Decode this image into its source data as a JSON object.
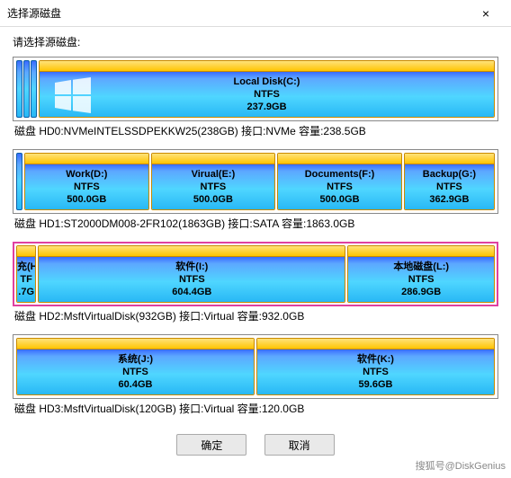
{
  "window": {
    "title": "选择源磁盘",
    "close_label": "×"
  },
  "prompt": "请选择源磁盘:",
  "disks": [
    {
      "label": "磁盘 HD0:NVMeINTELSSDPEKKW25(238GB)  接口:NVMe  容量:238.5GB",
      "reserved_bars": 3,
      "has_win_logo": true,
      "selected": false,
      "partitions": [
        {
          "name": "Local Disk(C:)",
          "fs": "NTFS",
          "size": "237.9GB",
          "flex": 1
        }
      ]
    },
    {
      "label": "磁盘 HD1:ST2000DM008-2FR102(1863GB)  接口:SATA  容量:1863.0GB",
      "reserved_bars": 1,
      "selected": false,
      "partitions": [
        {
          "name": "Work(D:)",
          "fs": "NTFS",
          "size": "500.0GB",
          "flex": 500
        },
        {
          "name": "Virual(E:)",
          "fs": "NTFS",
          "size": "500.0GB",
          "flex": 500
        },
        {
          "name": "Documents(F:)",
          "fs": "NTFS",
          "size": "500.0GB",
          "flex": 500
        },
        {
          "name": "Backup(G:)",
          "fs": "NTFS",
          "size": "362.9GB",
          "flex": 363
        }
      ]
    },
    {
      "label": "磁盘 HD2:MsftVirtualDisk(932GB)  接口:Virtual  容量:932.0GB",
      "reserved_bars": 0,
      "selected": true,
      "partitions": [
        {
          "name": "充(H",
          "fs": "TF",
          "size": ".7G",
          "flex": 36,
          "truncated": true
        },
        {
          "name": "软件(I:)",
          "fs": "NTFS",
          "size": "604.4GB",
          "flex": 604
        },
        {
          "name": "本地磁盘(L:)",
          "fs": "NTFS",
          "size": "286.9GB",
          "flex": 287
        }
      ]
    },
    {
      "label": "磁盘 HD3:MsftVirtualDisk(120GB)  接口:Virtual  容量:120.0GB",
      "reserved_bars": 0,
      "selected": false,
      "partitions": [
        {
          "name": "系统(J:)",
          "fs": "NTFS",
          "size": "60.4GB",
          "flex": 60
        },
        {
          "name": "软件(K:)",
          "fs": "NTFS",
          "size": "59.6GB",
          "flex": 60
        }
      ]
    }
  ],
  "buttons": {
    "ok": "确定",
    "cancel": "取消"
  },
  "watermark": "搜狐号@DiskGenius"
}
